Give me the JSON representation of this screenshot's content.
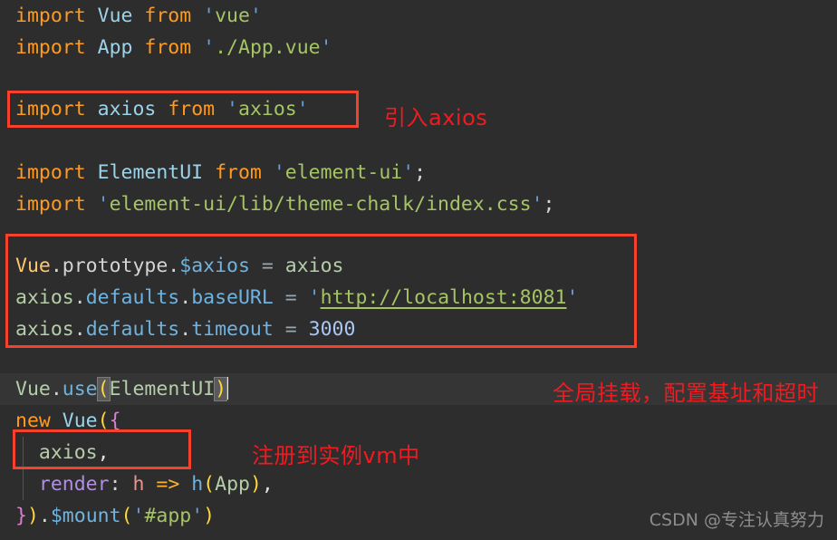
{
  "editor": {
    "background_color": "#2d2d2d",
    "current_line_color": "#353535",
    "annotation_color": "#ee1c21",
    "box_color": "#f6412d"
  },
  "code": {
    "line1": {
      "kw_import": "import",
      "ident": "Vue",
      "kw_from": "from",
      "quote_open": "'",
      "string": "vue",
      "quote_close": "'"
    },
    "line2": {
      "kw_import": "import",
      "ident": "App",
      "kw_from": "from",
      "quote_open": "'",
      "string": "./App.vue",
      "quote_close": "'"
    },
    "line3": {
      "kw_import": "import",
      "ident": "axios",
      "kw_from": "from",
      "quote_open": "'",
      "string": "axios",
      "quote_close": "'"
    },
    "line4": {
      "kw_import": "import",
      "ident": "ElementUI",
      "kw_from": "from",
      "quote_open": "'",
      "string": "element-ui",
      "quote_close": "'",
      "semicolon": ";"
    },
    "line5": {
      "kw_import": "import",
      "quote_open": "'",
      "string": "element-ui/lib/theme-chalk/index.css",
      "quote_close": "'",
      "semicolon": ";"
    },
    "line6": {
      "class_ref": "Vue",
      "dot1": ".",
      "prop": "prototype",
      "dot2": ".",
      "member": "$axios",
      "operator": "=",
      "value": "axios"
    },
    "line7": {
      "object": "axios",
      "dot1": ".",
      "prop1": "defaults",
      "dot2": ".",
      "prop2": "baseURL",
      "operator": "=",
      "quote_open": "'",
      "url": "http://localhost:8081",
      "quote_close": "'"
    },
    "line8": {
      "object": "axios",
      "dot1": ".",
      "prop1": "defaults",
      "dot2": ".",
      "prop2": "timeout",
      "operator": "=",
      "number": "3000"
    },
    "line9": {
      "object": "Vue",
      "dot": ".",
      "method": "use",
      "paren_open": "(",
      "argument": "ElementUI",
      "paren_close": ")"
    },
    "line10": {
      "kw_new": "new",
      "constructor": "Vue",
      "paren_open": "(",
      "brace_open": "{"
    },
    "line11": {
      "property": "axios",
      "comma": ","
    },
    "line12": {
      "key": "render",
      "colon": ":",
      "param": "h",
      "arrow": "=>",
      "fn": "h",
      "paren_open": "(",
      "arg": "App",
      "paren_close": ")",
      "comma": ","
    },
    "line13": {
      "brace_close": "}",
      "paren_close": ")",
      "dot": ".",
      "method": "$mount",
      "paren_open2": "(",
      "quote_open": "'",
      "string": "#app",
      "quote_close": "'",
      "paren_close2": ")"
    }
  },
  "annotations": [
    {
      "id": "annot-import-axios",
      "text": "引入axios"
    },
    {
      "id": "annot-global-mount",
      "text": "全局挂载，配置基址和超时"
    },
    {
      "id": "annot-register-vm",
      "text": "注册到实例vm中"
    }
  ],
  "highlight_boxes": [
    {
      "id": "box-import-axios",
      "label": "import axios line highlight"
    },
    {
      "id": "box-axios-config",
      "label": "axios global config block highlight"
    },
    {
      "id": "box-axios-property",
      "label": "axios property registration highlight"
    }
  ],
  "watermark": {
    "text": "CSDN @专注认真努力"
  }
}
